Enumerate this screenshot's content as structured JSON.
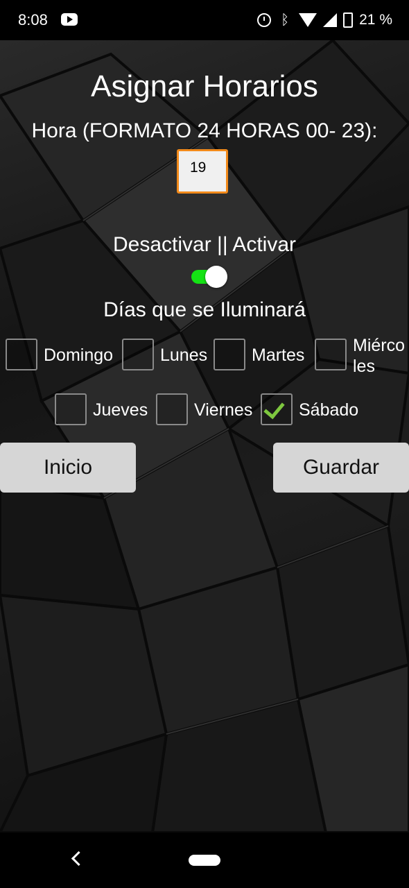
{
  "status_bar": {
    "time": "8:08",
    "battery": "21 %",
    "icons": [
      "youtube-icon",
      "alarm-icon",
      "bluetooth-icon",
      "wifi-icon",
      "signal-icon",
      "battery-icon"
    ]
  },
  "main": {
    "title": "Asignar Horarios",
    "hour_label": "Hora (FORMATO 24 HORAS 00- 23):",
    "hour_value": "19",
    "toggle_label": "Desactivar || Activar",
    "toggle_on": true,
    "days_label": "Días que se Iluminará",
    "days": [
      {
        "label": "Domingo",
        "checked": false
      },
      {
        "label": "Lunes",
        "checked": false
      },
      {
        "label": "Martes",
        "checked": false
      },
      {
        "label": "Miércoles",
        "label_line1": "Miérco",
        "label_line2": "les",
        "checked": false
      },
      {
        "label": "Jueves",
        "checked": false
      },
      {
        "label": "Viernes",
        "checked": false
      },
      {
        "label": "Sábado",
        "checked": true
      }
    ],
    "buttons": {
      "inicio": "Inicio",
      "guardar": "Guardar"
    }
  },
  "colors": {
    "accent_border": "#f28a1a",
    "toggle_on": "#14e314",
    "check": "#7ec73f",
    "button_bg": "#d6d6d6"
  }
}
